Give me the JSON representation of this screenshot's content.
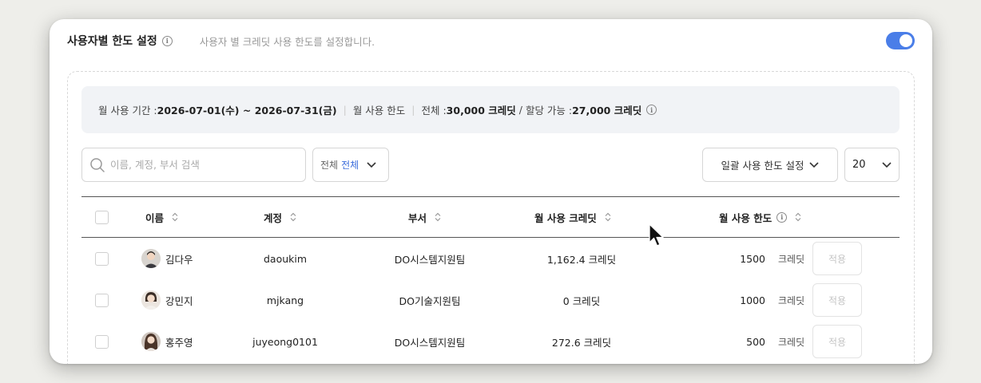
{
  "header": {
    "title": "사용자별 한도 설정",
    "description": "사용자 별 크레딧 사용 한도를 설정합니다.",
    "toggle_on": true
  },
  "summary": {
    "period_label": "월 사용 기간 : ",
    "period_value": "2026-07-01(수) ~ 2026-07-31(금)",
    "limit_label": "월 사용 한도",
    "total_label": "전체 : ",
    "total_value": "30,000 크레딧",
    "slash": " / ",
    "assignable_label": "할당 가능 : ",
    "assignable_value": "27,000 크레딧"
  },
  "toolbar": {
    "search_placeholder": "이름, 계정, 부서 검색",
    "filter_label": "전체",
    "filter_value": "전체",
    "bulk_label": "일괄 사용 한도 설정",
    "page_size": "20"
  },
  "table": {
    "headers": {
      "name": "이름",
      "account": "계정",
      "department": "부서",
      "monthly_credits": "월 사용 크레딧",
      "monthly_limit": "월 사용 한도"
    },
    "rows": [
      {
        "name": "김다우",
        "account": "daoukim",
        "department": "DO시스템지원팀",
        "credits": "1,162.4 크레딧",
        "limit": "1500",
        "unit": "크레딧",
        "apply": "적용"
      },
      {
        "name": "강민지",
        "account": "mjkang",
        "department": "DO기술지원팀",
        "credits": "0 크레딧",
        "limit": "1000",
        "unit": "크레딧",
        "apply": "적용"
      },
      {
        "name": "홍주영",
        "account": "juyeong0101",
        "department": "DO시스템지원팀",
        "credits": "272.6 크레딧",
        "limit": "500",
        "unit": "크레딧",
        "apply": "적용"
      }
    ]
  },
  "colors": {
    "accent": "#4a7ee8",
    "link": "#3f6fdc",
    "summary_bg": "#f1f3f6"
  },
  "icons": [
    "info-icon",
    "search-icon",
    "chevron-down-icon",
    "sort-icon",
    "mouse-cursor-icon"
  ]
}
